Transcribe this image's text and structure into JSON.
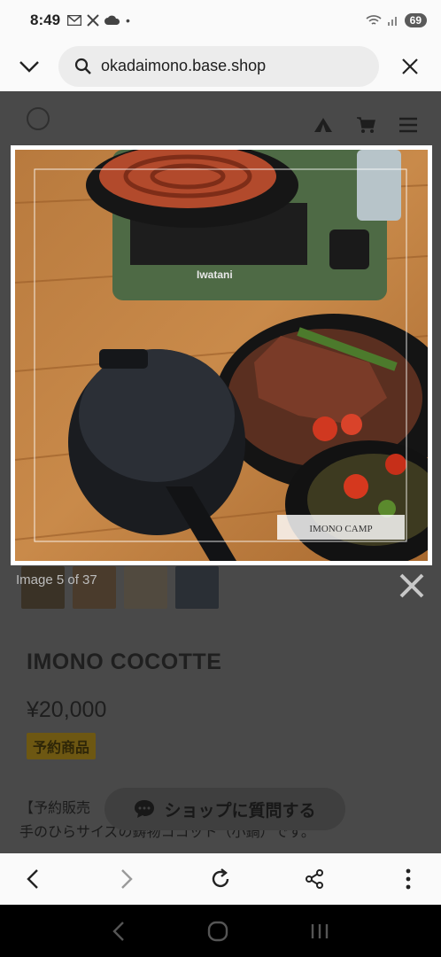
{
  "status_bar": {
    "time": "8:49",
    "battery": "69"
  },
  "url_bar": {
    "url": "okadaimono.base.shop"
  },
  "lightbox": {
    "counter": "Image 5 of 37",
    "image_caption": "IMONO CAMP",
    "stove_brand": "Iwatani"
  },
  "product": {
    "title": "IMONO COCOTTE",
    "price": "¥20,000",
    "badge": "予約商品",
    "description_line1": "【予約販売",
    "description_line2": "手のひらサイズの鋳物ココット（小鍋）です。"
  },
  "chat": {
    "label": "ショップに質問する"
  },
  "colors": {
    "overlay": "#494949",
    "bar": "#fafafa",
    "badge": "#6d5712"
  }
}
